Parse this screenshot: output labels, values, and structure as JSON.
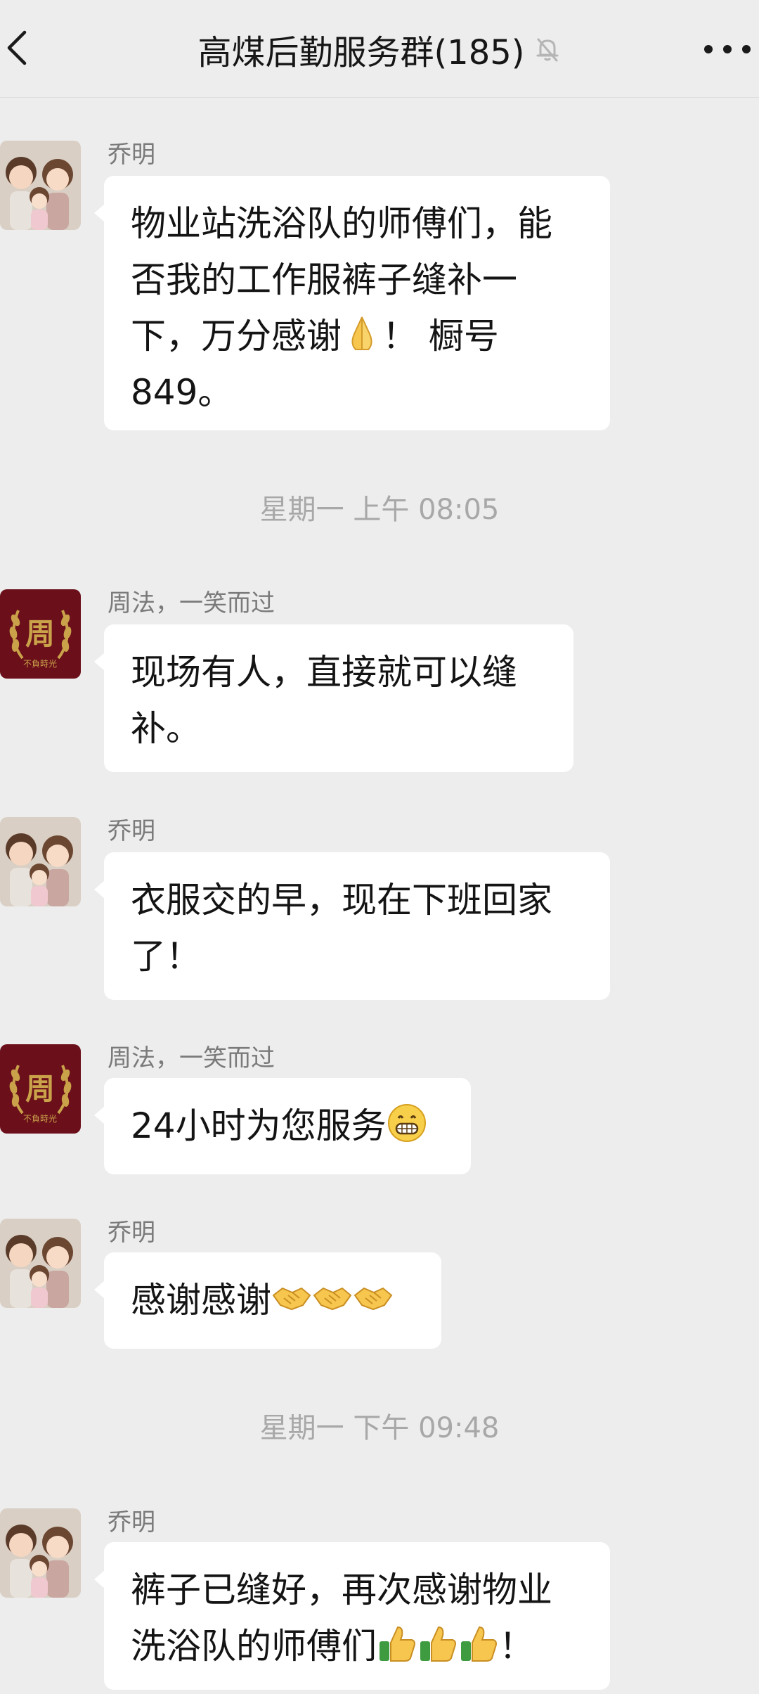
{
  "header": {
    "title": "高煤后勤服务群(185)",
    "back_icon": "chevron-left-icon",
    "mute_icon": "bell-off-icon",
    "more_icon": "more-dots-icon"
  },
  "messages": [
    {
      "sender": "乔明",
      "avatar": "family-cartoon-avatar",
      "text": "物业站洗浴队的师傅们，能\n否我的工作服裤子缝补一\n下，万分感谢",
      "text_after": "！ 橱号\n849。",
      "emoji": "folded-hands-icon"
    },
    {
      "sender": "周法，一笑而过",
      "avatar": "zhou-laurel-avatar",
      "text": "现场有人，直接就可以缝\n补。"
    },
    {
      "sender": "乔明",
      "avatar": "family-cartoon-avatar",
      "text": "衣服交的早，现在下班回家\n了！"
    },
    {
      "sender": "周法，一笑而过",
      "avatar": "zhou-laurel-avatar",
      "text": "24小时为您服务",
      "emoji": "grinning-face-icon"
    },
    {
      "sender": "乔明",
      "avatar": "family-cartoon-avatar",
      "text": "感谢感谢",
      "emoji": "handshake-icon"
    },
    {
      "sender": "乔明",
      "avatar": "family-cartoon-avatar",
      "text": "裤子已缝好，再次感谢物业\n洗浴队的师傅们",
      "text_after": "！",
      "emoji": "thumbs-up-icon"
    }
  ],
  "timestamps": [
    "星期一 上午 08:05",
    "星期一 下午 09:48"
  ],
  "zhou_avatar": {
    "character": "周",
    "caption": "不負時光"
  },
  "colors": {
    "background": "#ededed",
    "bubble": "#ffffff",
    "meta_text": "#a8a8a8",
    "sender_text": "#7a7a7a",
    "zhou_avatar_bg": "#6b0f1a",
    "laurel": "#c9a24a"
  }
}
